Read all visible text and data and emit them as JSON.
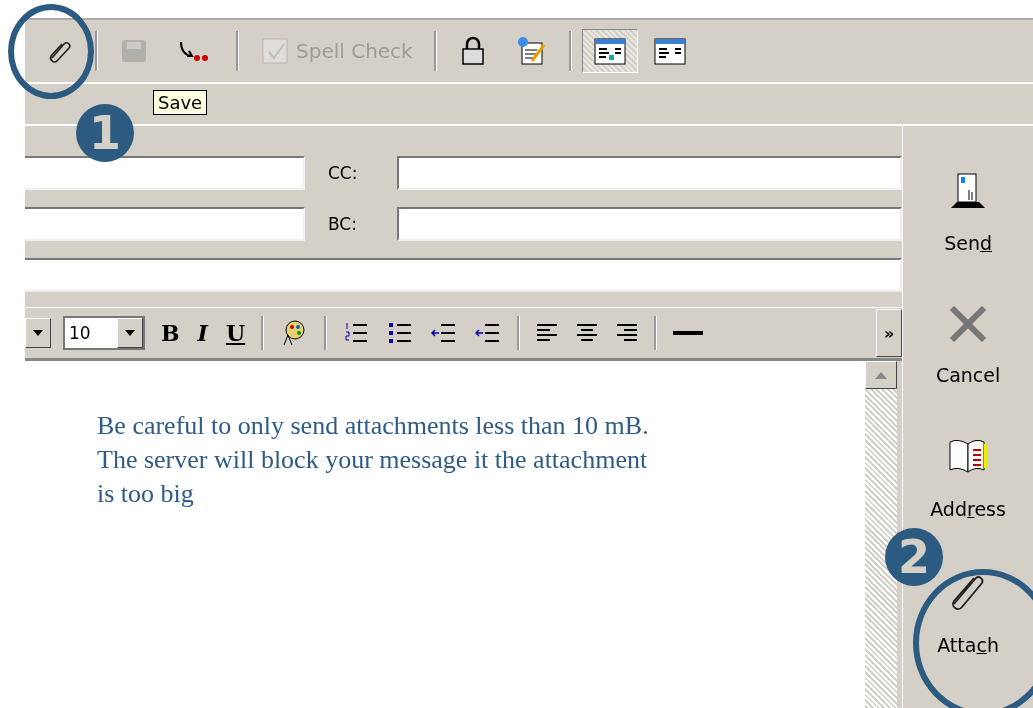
{
  "toolbar": [
    {
      "kind": "button",
      "disabled": false,
      "pressed": false
    },
    {
      "kind": "separator"
    },
    {
      "kind": "button",
      "disabled": true,
      "pressed": false
    },
    {
      "kind": "button",
      "disabled": false,
      "pressed": false
    },
    {
      "kind": "separator"
    },
    {
      "kind": "button",
      "label": "Spell Check",
      "disabled": true,
      "pressed": false
    },
    {
      "kind": "separator"
    },
    {
      "kind": "button",
      "disabled": false,
      "pressed": false
    },
    {
      "kind": "button",
      "disabled": false,
      "pressed": false
    },
    {
      "kind": "separator"
    },
    {
      "kind": "button",
      "disabled": false,
      "pressed": true
    },
    {
      "kind": "button",
      "disabled": false,
      "pressed": false
    }
  ],
  "tooltip": "Save",
  "fields": [
    {
      "label": "CC:"
    },
    {
      "label": "BC:"
    }
  ],
  "format_toolbar": {
    "font_size": "10",
    "bold": "B",
    "italic": "I",
    "underline": "U",
    "more": "»"
  },
  "body": [
    "Be careful to only send attachments less than 10 mB.",
    "The server will block your message it the attachment",
    "is too big"
  ],
  "side_buttons": [
    {
      "pre": "Sen",
      "key": "d"
    },
    {
      "pre": "Cancel"
    },
    {
      "pre": "Add",
      "key": "r",
      "post": "ess"
    },
    {
      "pre": "Atta",
      "key": "c",
      "post": "h"
    }
  ],
  "annotations": [
    {
      "number": "1"
    },
    {
      "number": "2"
    }
  ]
}
